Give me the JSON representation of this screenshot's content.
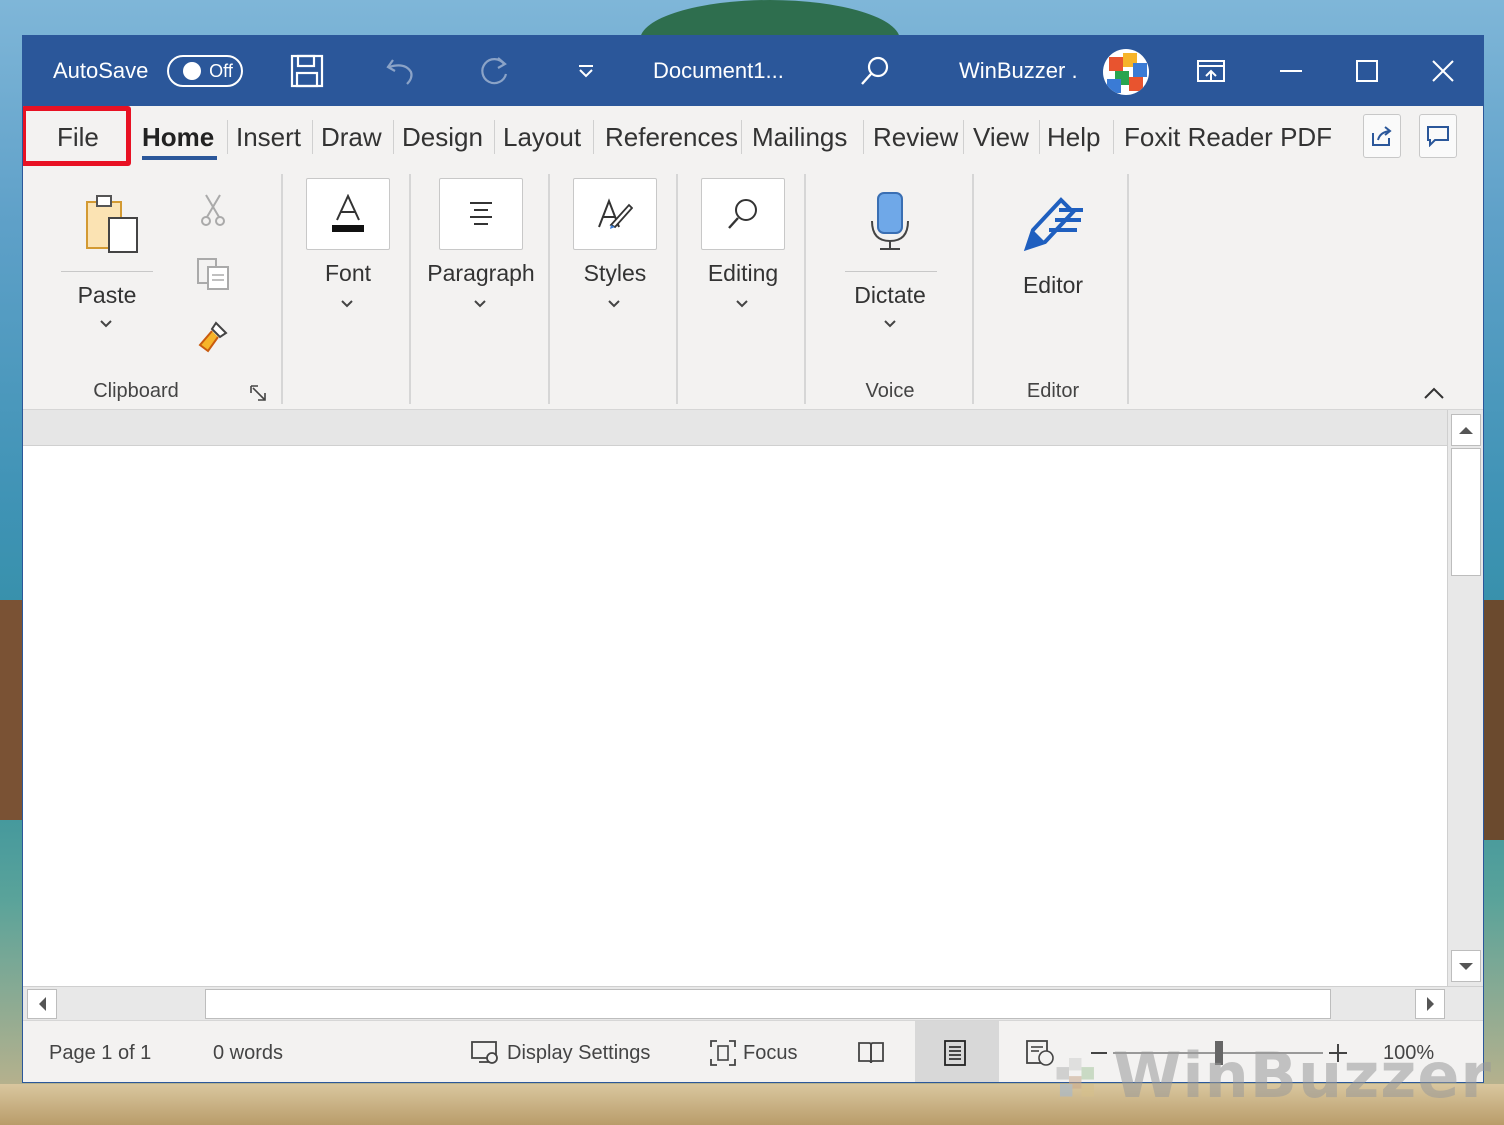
{
  "titlebar": {
    "autosave_label": "AutoSave",
    "autosave_state": "Off",
    "document_title": "Document1...",
    "user_name": "WinBuzzer ."
  },
  "tabs": [
    {
      "label": "File"
    },
    {
      "label": "Home"
    },
    {
      "label": "Insert"
    },
    {
      "label": "Draw"
    },
    {
      "label": "Design"
    },
    {
      "label": "Layout"
    },
    {
      "label": "References"
    },
    {
      "label": "Mailings"
    },
    {
      "label": "Review"
    },
    {
      "label": "View"
    },
    {
      "label": "Help"
    },
    {
      "label": "Foxit Reader PDF"
    }
  ],
  "ribbon": {
    "paste_label": "Paste",
    "clipboard_group": "Clipboard",
    "font_label": "Font",
    "paragraph_label": "Paragraph",
    "styles_label": "Styles",
    "editing_label": "Editing",
    "dictate_label": "Dictate",
    "voice_group": "Voice",
    "editor_label": "Editor",
    "editor_group": "Editor"
  },
  "statusbar": {
    "page": "Page 1 of 1",
    "words": "0 words",
    "display_settings": "Display Settings",
    "focus": "Focus",
    "zoom": "100%"
  },
  "watermark": {
    "text": "WinBuzzer"
  },
  "colors": {
    "titlebar": "#2b579a",
    "highlight": "#e81123",
    "accent": "#2b579a"
  }
}
